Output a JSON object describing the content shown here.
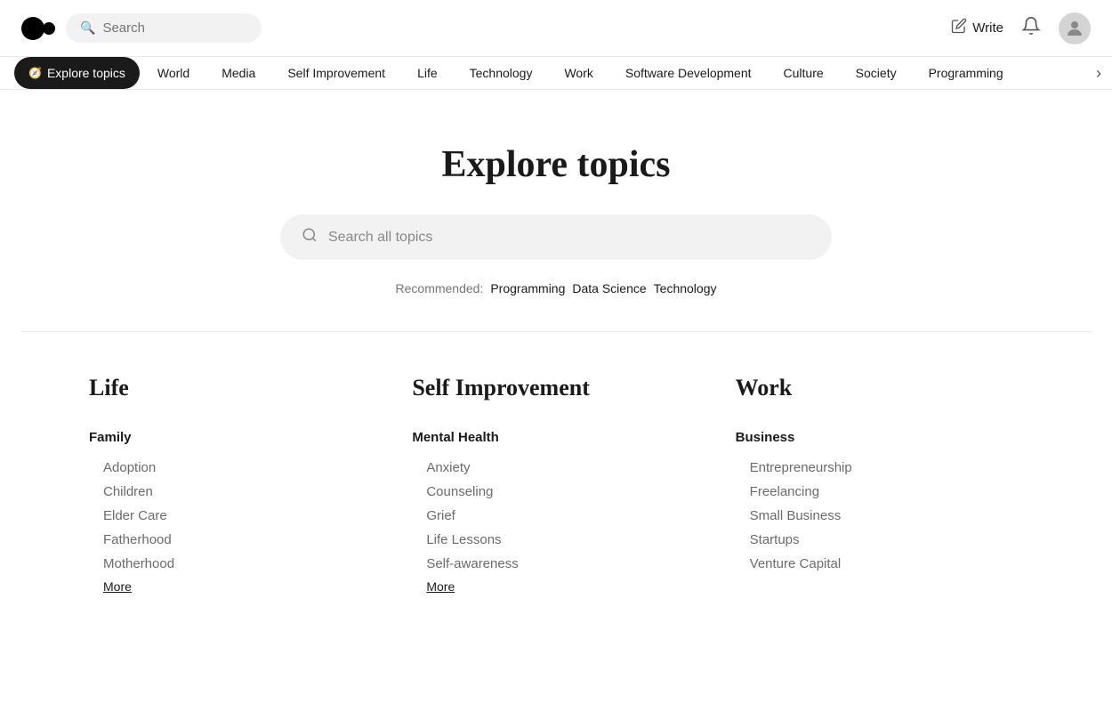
{
  "header": {
    "search_placeholder": "Search",
    "write_label": "Write",
    "logo_alt": "Medium logo"
  },
  "topics_nav": {
    "items": [
      {
        "id": "explore",
        "label": "Explore topics",
        "active": true,
        "has_icon": true
      },
      {
        "id": "world",
        "label": "World",
        "active": false
      },
      {
        "id": "media",
        "label": "Media",
        "active": false
      },
      {
        "id": "self-improvement",
        "label": "Self Improvement",
        "active": false
      },
      {
        "id": "life",
        "label": "Life",
        "active": false
      },
      {
        "id": "technology",
        "label": "Technology",
        "active": false
      },
      {
        "id": "work",
        "label": "Work",
        "active": false
      },
      {
        "id": "software-development",
        "label": "Software Development",
        "active": false
      },
      {
        "id": "culture",
        "label": "Culture",
        "active": false
      },
      {
        "id": "society",
        "label": "Society",
        "active": false
      },
      {
        "id": "programming",
        "label": "Programming",
        "active": false
      }
    ],
    "more_icon": "›"
  },
  "hero": {
    "title": "Explore topics",
    "search_placeholder": "Search all topics",
    "recommended_label": "Recommended:",
    "recommended_items": [
      {
        "label": "Programming"
      },
      {
        "label": "Data Science"
      },
      {
        "label": "Technology"
      }
    ]
  },
  "categories": [
    {
      "id": "life",
      "title": "Life",
      "subcategories": [
        {
          "title": "Family",
          "items": [
            "Adoption",
            "Children",
            "Elder Care",
            "Fatherhood",
            "Motherhood"
          ],
          "more_label": "More"
        }
      ]
    },
    {
      "id": "self-improvement",
      "title": "Self Improvement",
      "subcategories": [
        {
          "title": "Mental Health",
          "items": [
            "Anxiety",
            "Counseling",
            "Grief",
            "Life Lessons",
            "Self-awareness"
          ],
          "more_label": "More"
        }
      ]
    },
    {
      "id": "work",
      "title": "Work",
      "subcategories": [
        {
          "title": "Business",
          "items": [
            "Entrepreneurship",
            "Freelancing",
            "Small Business",
            "Startups",
            "Venture Capital"
          ],
          "more_label": null
        }
      ]
    }
  ]
}
